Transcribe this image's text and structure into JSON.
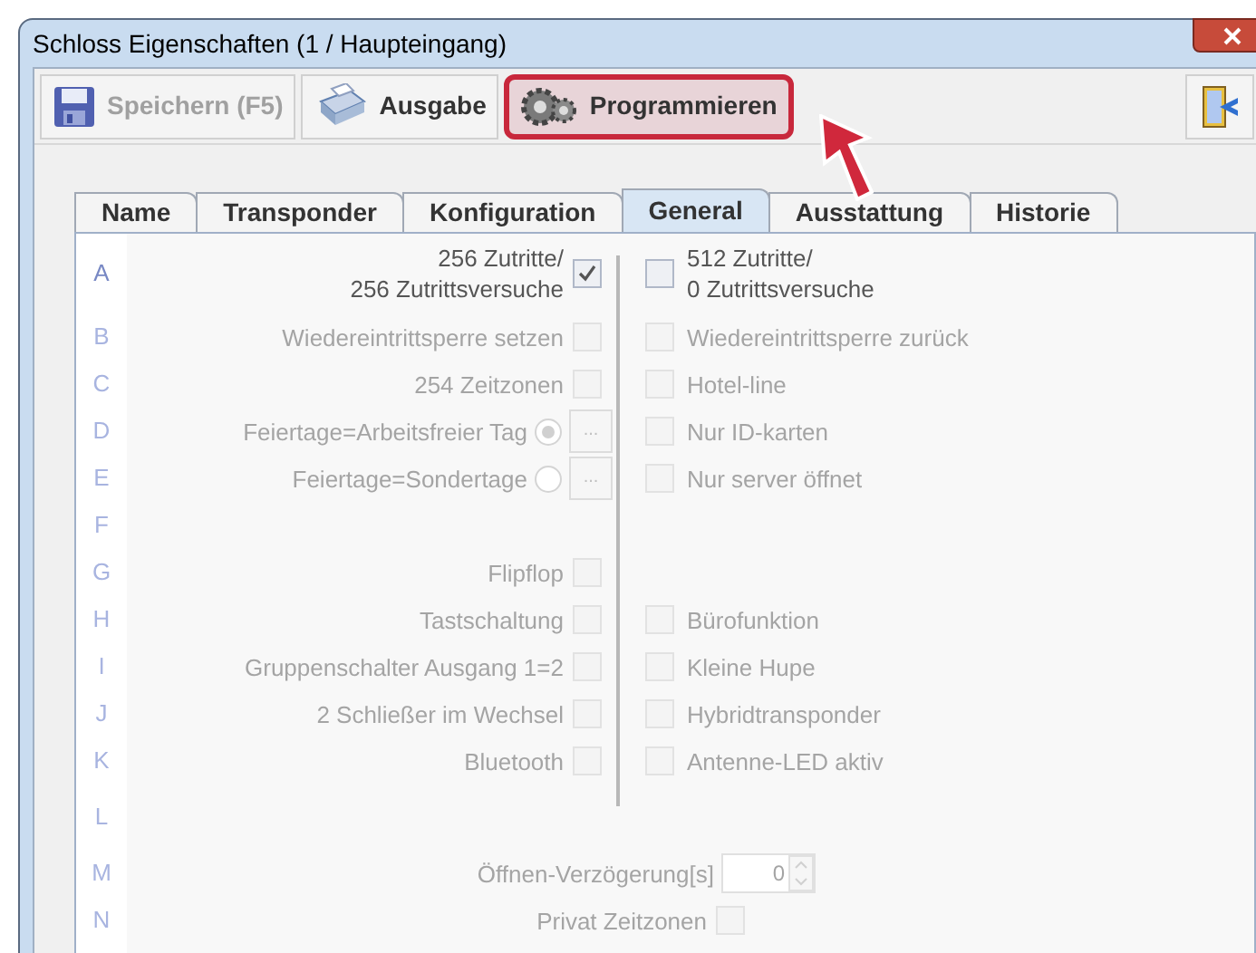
{
  "window": {
    "title": "Schloss Eigenschaften (1 / Haupteingang)"
  },
  "toolbar": [
    {
      "label": "Speichern (F5)",
      "kind": "save",
      "disabled": true,
      "highlighted": false
    },
    {
      "label": "Ausgabe",
      "kind": "print",
      "disabled": false,
      "highlighted": false
    },
    {
      "label": "Programmieren",
      "kind": "gears",
      "disabled": false,
      "highlighted": true
    }
  ],
  "tabs": [
    {
      "label": "Name",
      "selected": false
    },
    {
      "label": "Transponder",
      "selected": false
    },
    {
      "label": "Konfiguration",
      "selected": false
    },
    {
      "label": "General",
      "selected": true
    },
    {
      "label": "Ausstattung",
      "selected": false
    },
    {
      "label": "Historie",
      "selected": false
    }
  ],
  "rows": [
    {
      "letter": "A",
      "disabled": false,
      "left": {
        "kind": "checkbox",
        "label": "256 Zutritte/\n256 Zutrittsversuche",
        "checked": true
      },
      "right": {
        "kind": "checkbox",
        "label": "512 Zutritte/\n0 Zutrittsversuche",
        "checked": false
      }
    },
    {
      "letter": "B",
      "disabled": true,
      "left": {
        "kind": "checkbox",
        "label": "Wiedereintrittsperre setzen",
        "checked": false
      },
      "right": {
        "kind": "checkbox",
        "label": "Wiedereintrittsperre zurück",
        "checked": false
      }
    },
    {
      "letter": "C",
      "disabled": true,
      "left": {
        "kind": "checkbox",
        "label": "254 Zeitzonen",
        "checked": false
      },
      "right": {
        "kind": "checkbox",
        "label": "Hotel-line",
        "checked": false
      }
    },
    {
      "letter": "D",
      "disabled": true,
      "left": {
        "kind": "radio",
        "label": "Feiertage=Arbeitsfreier Tag",
        "selected": true,
        "button": "..."
      },
      "right": {
        "kind": "checkbox",
        "label": "Nur ID-karten",
        "checked": false
      }
    },
    {
      "letter": "E",
      "disabled": true,
      "left": {
        "kind": "radio",
        "label": "Feiertage=Sondertage",
        "selected": false,
        "button": "..."
      },
      "right": {
        "kind": "checkbox",
        "label": "Nur server öffnet",
        "checked": false
      }
    },
    {
      "letter": "F",
      "disabled": true
    },
    {
      "letter": "G",
      "disabled": true,
      "left": {
        "kind": "checkbox",
        "label": "Flipflop",
        "checked": false
      }
    },
    {
      "letter": "H",
      "disabled": true,
      "left": {
        "kind": "checkbox",
        "label": "Tastschaltung",
        "checked": false
      },
      "right": {
        "kind": "checkbox",
        "label": "Bürofunktion",
        "checked": false
      }
    },
    {
      "letter": "I",
      "disabled": true,
      "left": {
        "kind": "checkbox",
        "label": "Gruppenschalter Ausgang 1=2",
        "checked": false
      },
      "right": {
        "kind": "checkbox",
        "label": "Kleine Hupe",
        "checked": false
      }
    },
    {
      "letter": "J",
      "disabled": true,
      "left": {
        "kind": "checkbox",
        "label": "2 Schließer im Wechsel",
        "checked": false
      },
      "right": {
        "kind": "checkbox",
        "label": "Hybridtransponder",
        "checked": false
      }
    },
    {
      "letter": "K",
      "disabled": true,
      "left": {
        "kind": "checkbox",
        "label": "Bluetooth",
        "checked": false
      },
      "right": {
        "kind": "checkbox",
        "label": "Antenne-LED aktiv",
        "checked": false
      }
    },
    {
      "letter": "L",
      "disabled": true
    },
    {
      "letter": "M",
      "disabled": true,
      "wide": {
        "kind": "spinner",
        "label": "Öffnen-Verzögerung[s]",
        "value": "0"
      }
    },
    {
      "letter": "N",
      "disabled": true,
      "wide": {
        "kind": "checkbox",
        "label": "Privat Zeitzonen",
        "checked": false
      }
    }
  ]
}
